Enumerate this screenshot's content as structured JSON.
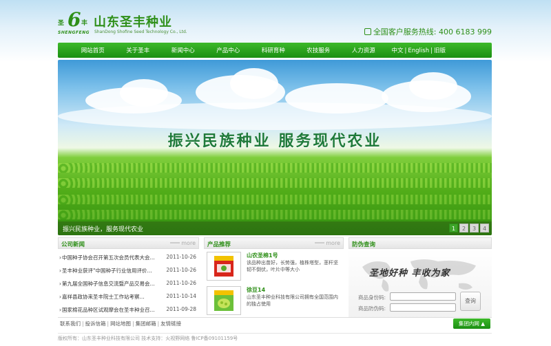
{
  "header": {
    "logo_mark_left": "圣",
    "logo_mark_six": "6",
    "logo_mark_right": "丰",
    "logo_mark_en": "SHENGFENG",
    "company_cn": "山东圣丰种业",
    "company_en": "ShanDong Shofine Seed Technology Co., Ltd.",
    "hotline": "全国客户服务热线: 400 6183 999"
  },
  "nav": {
    "items": [
      "网站首页",
      "关于圣丰",
      "新闻中心",
      "产品中心",
      "科研育种",
      "农技服务",
      "人力资源"
    ],
    "lang": [
      "中文",
      "English",
      "旧版"
    ],
    "lang_sep": "|"
  },
  "banner": {
    "slogan": "振兴民族种业  服务现代农业",
    "caption": "振兴民族种业，服务现代农业",
    "pages": [
      "1",
      "2",
      "3",
      "4"
    ],
    "active_page": "1"
  },
  "news": {
    "title": "公司新闻",
    "more": "more",
    "items": [
      {
        "title": "中国种子协会召开第五次会员代表大会...",
        "date": "2011-10-26"
      },
      {
        "title": "圣丰种业获评\"中国种子行业信用评价...",
        "date": "2011-10-26"
      },
      {
        "title": "第九届全国种子信息交流暨产品交易会...",
        "date": "2011-10-26"
      },
      {
        "title": "嘉祥县政协来圣丰院士工作站考察...",
        "date": "2011-10-14"
      },
      {
        "title": "国家棉花品种区试观摩会在圣丰种业召...",
        "date": "2011-09-28"
      }
    ]
  },
  "products": {
    "title": "产品推荐",
    "more": "more",
    "items": [
      {
        "name": "山农圣棉1号",
        "desc": "该品种出苗好，长势强，植株塔型，茎秆坚韧不倒伏，叶片中等大小"
      },
      {
        "name": "徐豆14",
        "desc": "山东圣丰种业科技有限公司拥有全国范围内的独占使用"
      }
    ]
  },
  "query": {
    "title": "防伪查询",
    "calligraphy": "圣地好种  丰收为家",
    "id_label": "商品身份码:",
    "code_label": "商品防伪码:",
    "button": "查询"
  },
  "footer": {
    "links": [
      "联系我们",
      "投诉信箱",
      "网站地图",
      "集团邮箱",
      "友情链接"
    ],
    "group_button": "集团内网 ▲",
    "copyright": "版权所有：山东圣丰种业科技有限公司  技术支持：火视野网络  鲁ICP备09101159号"
  },
  "colors": {
    "brand_green": "#2e8f18",
    "nav_green": "#1a8f12"
  }
}
